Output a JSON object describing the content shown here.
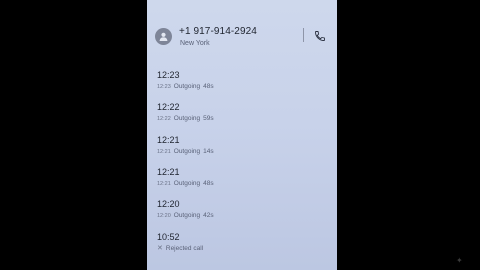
{
  "contact": {
    "number": "+1 917-914-2924",
    "location": "New York"
  },
  "icons": {
    "avatar": "person-icon",
    "call": "phone-icon",
    "rejected": "x-icon"
  },
  "calls": [
    {
      "time": "12:23",
      "sub_time": "12:23",
      "type": "Outgoing",
      "duration": "48s"
    },
    {
      "time": "12:22",
      "sub_time": "12:22",
      "type": "Outgoing",
      "duration": "59s"
    },
    {
      "time": "12:21",
      "sub_time": "12:21",
      "type": "Outgoing",
      "duration": "14s"
    },
    {
      "time": "12:21",
      "sub_time": "12:21",
      "type": "Outgoing",
      "duration": "48s"
    },
    {
      "time": "12:20",
      "sub_time": "12:20",
      "type": "Outgoing",
      "duration": "42s"
    },
    {
      "time": "10:52",
      "sub_time": "",
      "type": "Rejected call",
      "duration": ""
    }
  ]
}
